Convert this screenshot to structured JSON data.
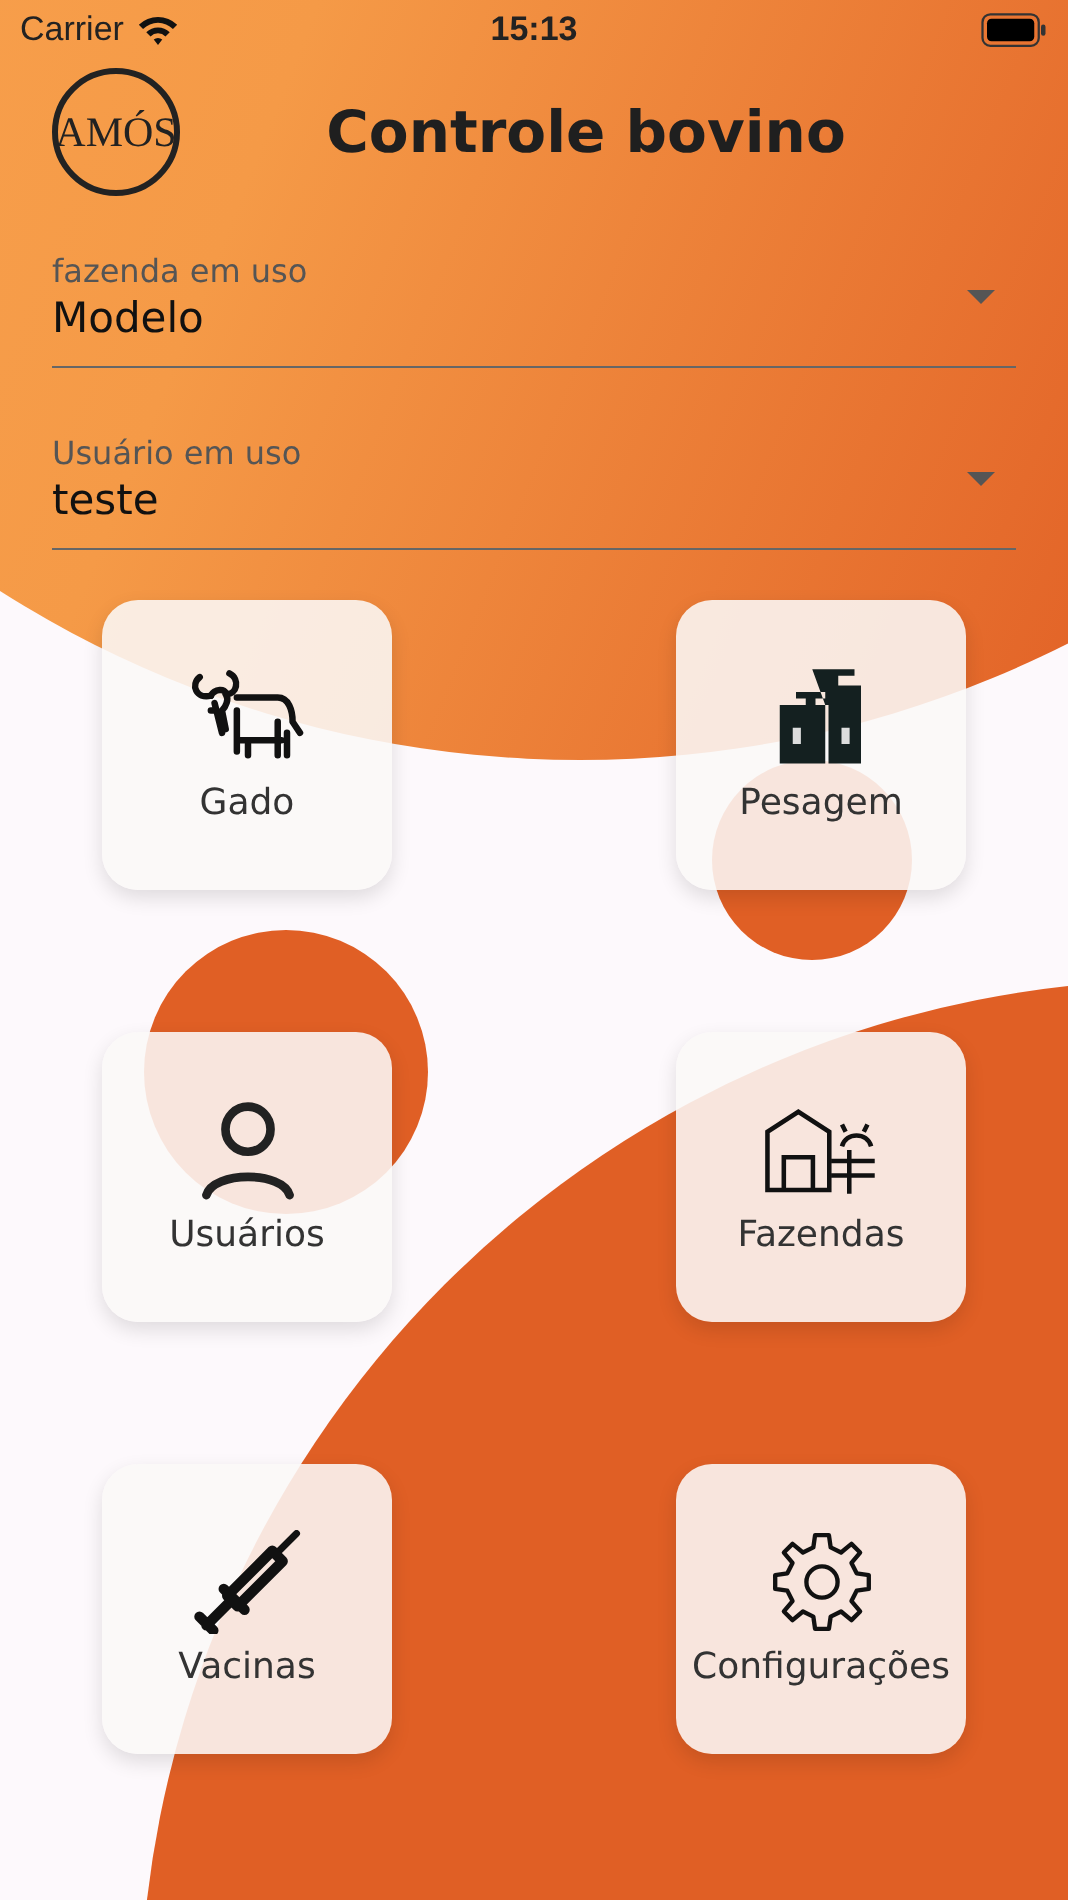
{
  "status_bar": {
    "carrier": "Carrier",
    "time": "15:13"
  },
  "header": {
    "logo_text": "AMÓS",
    "title": "Controle bovino"
  },
  "fields": [
    {
      "label": "fazenda em uso",
      "value": "Modelo"
    },
    {
      "label": "Usuário em uso",
      "value": "teste"
    }
  ],
  "menu": [
    {
      "kind": "cattle",
      "label": "Gado"
    },
    {
      "kind": "weights",
      "label": "Pesagem"
    },
    {
      "kind": "user",
      "label": "Usuários"
    },
    {
      "kind": "farm",
      "label": "Fazendas"
    },
    {
      "kind": "syringe",
      "label": "Vacinas"
    },
    {
      "kind": "gear",
      "label": "Configurações"
    }
  ]
}
